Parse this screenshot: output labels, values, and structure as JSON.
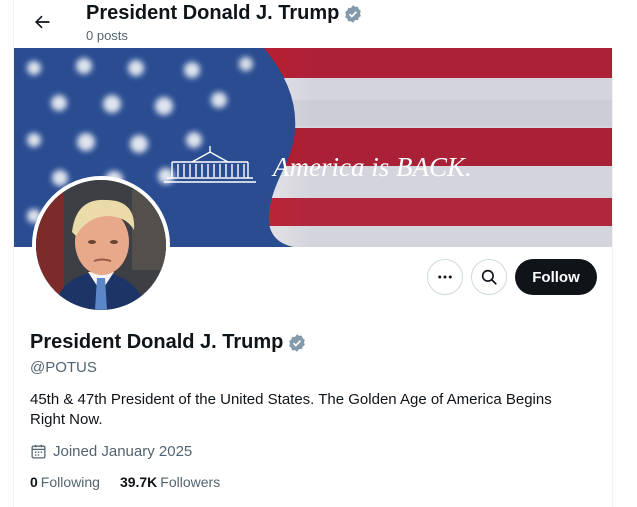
{
  "header": {
    "title": "President Donald J. Trump",
    "post_count": "0 posts"
  },
  "banner": {
    "text": "America is BACK."
  },
  "profile": {
    "name": "President Donald J. Trump",
    "handle": "@POTUS",
    "bio": "45th & 47th President of the United States. The Golden Age of America Begins Right Now.",
    "joined": "Joined January 2025",
    "verified_color": "#829aab"
  },
  "actions": {
    "follow_label": "Follow"
  },
  "stats": {
    "following_count": "0",
    "following_label": "Following",
    "followers_count": "39.7K",
    "followers_label": "Followers"
  },
  "icons": [
    "back-arrow-icon",
    "verified-badge-icon",
    "more-dots-icon",
    "search-icon",
    "calendar-icon"
  ]
}
